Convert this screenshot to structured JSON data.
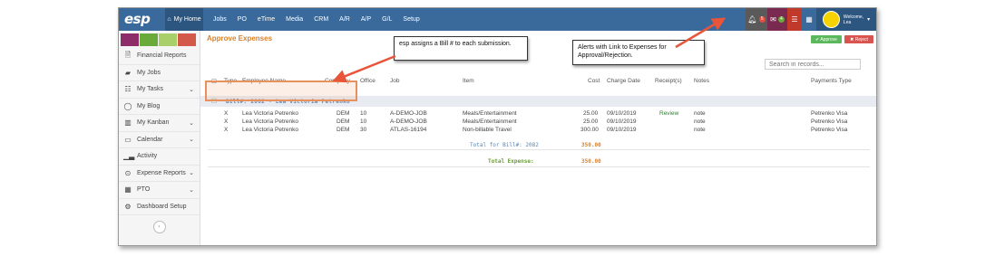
{
  "app": {
    "logo": "esp",
    "my_home": "My Home",
    "nav": [
      "Jobs",
      "PO",
      "eTime",
      "Media",
      "CRM",
      "A/R",
      "A/P",
      "G/L",
      "Setup"
    ],
    "bell_count": "5",
    "mail_count": "4",
    "welcome_line1": "Welcome,",
    "welcome_line2": "Lea"
  },
  "sidebar": {
    "swatch_colors": [
      "#8e2c6a",
      "#6aaa3a",
      "#a9cf6a",
      "#d35a4a"
    ],
    "items": [
      {
        "label": "Financial Reports",
        "icon": "document-icon",
        "chev": ""
      },
      {
        "label": "My Jobs",
        "icon": "folder-icon",
        "chev": ""
      },
      {
        "label": "My Tasks",
        "icon": "list-icon",
        "chev": "⌄"
      },
      {
        "label": "My Blog",
        "icon": "chat-icon",
        "chev": ""
      },
      {
        "label": "My Kanban",
        "icon": "kanban-icon",
        "chev": "⌄"
      },
      {
        "label": "Calendar",
        "icon": "calendar-icon",
        "chev": "⌄"
      },
      {
        "label": "Activity",
        "icon": "chart-icon",
        "chev": ""
      },
      {
        "label": "Expense Reports",
        "icon": "money-icon",
        "chev": "⌄"
      },
      {
        "label": "PTO",
        "icon": "calendar-icon",
        "chev": "⌄"
      },
      {
        "label": "Dashboard Setup",
        "icon": "gears-icon",
        "chev": ""
      }
    ]
  },
  "main": {
    "title": "Approve Expenses",
    "approve_label": "✔ Approve",
    "reject_label": "✖ Reject",
    "search_placeholder": "Search in records...",
    "columns": {
      "type": "Type",
      "employee": "Employee Name",
      "company": "Company",
      "office": "Office",
      "job": "Job",
      "item": "Item",
      "cost": "Cost",
      "charge_date": "Charge Date",
      "receipts": "Receipt(s)",
      "notes": "Notes",
      "payments_type": "Payments Type"
    },
    "bill_label": "Bill#: 2082 - Lea Victoria Petrenko",
    "rows": [
      {
        "type": "X",
        "employee": "Lea Victoria Petrenko",
        "company": "DEM",
        "office": "10",
        "job": "A-DEMO-JOB",
        "item": "Meals/Entertainment",
        "cost": "25.00",
        "date": "09/10/2019",
        "receipt": "Review",
        "notes": "note",
        "payment": "Petrenko Visa"
      },
      {
        "type": "X",
        "employee": "Lea Victoria Petrenko",
        "company": "DEM",
        "office": "10",
        "job": "A-DEMO-JOB",
        "item": "Meals/Entertainment",
        "cost": "25.00",
        "date": "09/10/2019",
        "receipt": "",
        "notes": "note",
        "payment": "Petrenko Visa"
      },
      {
        "type": "X",
        "employee": "Lea Victoria Petrenko",
        "company": "DEM",
        "office": "30",
        "job": "ATLAS-16194",
        "item": "Non-billable Travel",
        "cost": "300.00",
        "date": "09/10/2019",
        "receipt": "",
        "notes": "note",
        "payment": "Petrenko Visa"
      }
    ],
    "total_bill_label": "Total for Bill#: 2082",
    "total_bill_value": "350.00",
    "total_expense_label": "Total Expense:",
    "total_expense_value": "350.00"
  },
  "callouts": {
    "bill": "esp assigns a Bill # to each submission.",
    "alerts": "Alerts with Link to Expenses for Approval/Rejection."
  },
  "colors": {
    "topbar": "#3a6a9c",
    "title": "#d9822b",
    "highlight": "#e8915c",
    "arrow": "#e8553a"
  }
}
